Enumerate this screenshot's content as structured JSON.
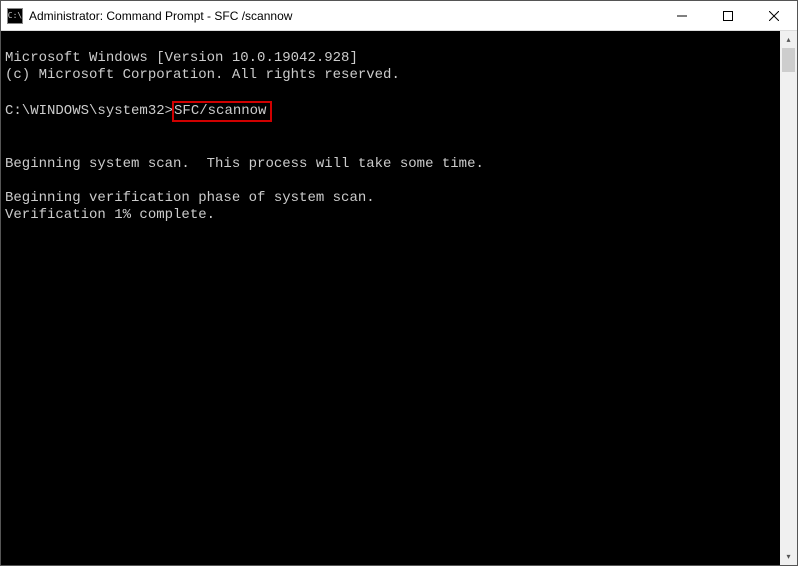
{
  "titlebar": {
    "icon_label": "C:\\",
    "title": "Administrator: Command Prompt - SFC /scannow"
  },
  "console": {
    "line1": "Microsoft Windows [Version 10.0.19042.928]",
    "line2": "(c) Microsoft Corporation. All rights reserved.",
    "blank1": "",
    "prompt_prefix": "C:\\WINDOWS\\system32>",
    "prompt_command": "SFC/scannow",
    "blank2": "",
    "scan1": "Beginning system scan.  This process will take some time.",
    "blank3": "",
    "verify1": "Beginning verification phase of system scan.",
    "verify2": "Verification 1% complete."
  },
  "scroll": {
    "up_glyph": "▴",
    "down_glyph": "▾"
  }
}
